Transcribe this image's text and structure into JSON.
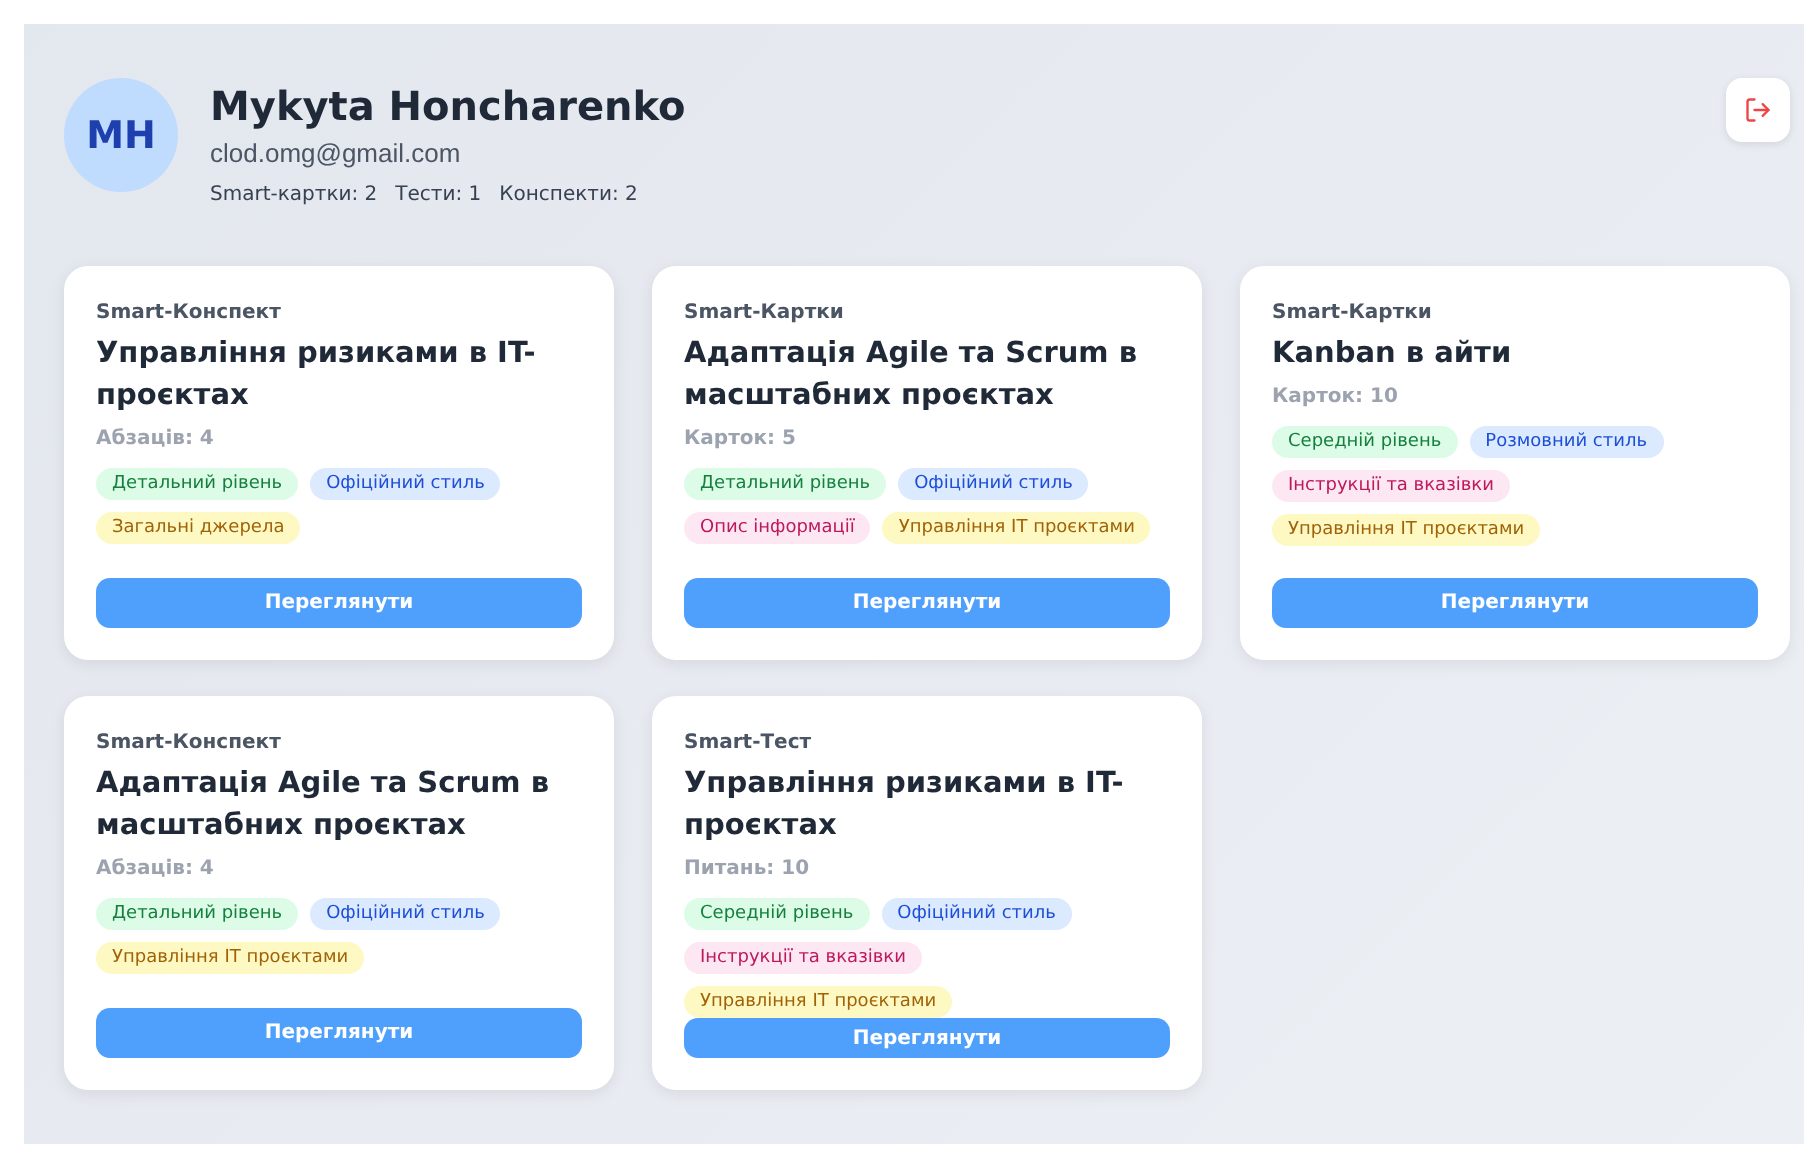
{
  "profile": {
    "initials": "MH",
    "name": "Mykyta Honcharenko",
    "email": "clod.omg@gmail.com",
    "stats": [
      "Smart-картки: 2",
      "Тести: 1",
      "Конспекти: 2"
    ]
  },
  "cards": [
    {
      "type": "Smart-Конспект",
      "title": "Управління ризиками в IT-проєктах",
      "count": "Абзаців: 4",
      "tags": [
        {
          "label": "Детальний рівень",
          "kind": "level"
        },
        {
          "label": "Офіційний стиль",
          "kind": "style"
        },
        {
          "label": "Загальні джерела",
          "kind": "subject"
        }
      ],
      "button": "Переглянути"
    },
    {
      "type": "Smart-Картки",
      "title": "Адаптація Agile та Scrum в масштабних проєктах",
      "count": "Карток: 5",
      "tags": [
        {
          "label": "Детальний рівень",
          "kind": "level"
        },
        {
          "label": "Офіційний стиль",
          "kind": "style"
        },
        {
          "label": "Опис інформації",
          "kind": "format"
        },
        {
          "label": "Управління IT проєктами",
          "kind": "subject"
        }
      ],
      "button": "Переглянути"
    },
    {
      "type": "Smart-Картки",
      "title": "Kanban в айти",
      "count": "Карток: 10",
      "tags": [
        {
          "label": "Середній рівень",
          "kind": "level"
        },
        {
          "label": "Розмовний стиль",
          "kind": "style"
        },
        {
          "label": "Інструкції та вказівки",
          "kind": "format"
        },
        {
          "label": "Управління IT проєктами",
          "kind": "subject"
        }
      ],
      "button": "Переглянути"
    },
    {
      "type": "Smart-Конспект",
      "title": "Адаптація Agile та Scrum в масштабних проєктах",
      "count": "Абзаців: 4",
      "tags": [
        {
          "label": "Детальний рівень",
          "kind": "level"
        },
        {
          "label": "Офіційний стиль",
          "kind": "style"
        },
        {
          "label": "Управління IT проєктами",
          "kind": "subject"
        }
      ],
      "button": "Переглянути"
    },
    {
      "type": "Smart-Тест",
      "title": "Управління ризиками в IT-проєктах",
      "count": "Питань: 10",
      "tags": [
        {
          "label": "Середній рівень",
          "kind": "level"
        },
        {
          "label": "Офіційний стиль",
          "kind": "style"
        },
        {
          "label": "Інструкції та вказівки",
          "kind": "format"
        },
        {
          "label": "Управління IT проєктами",
          "kind": "subject"
        }
      ],
      "button": "Переглянути"
    }
  ]
}
